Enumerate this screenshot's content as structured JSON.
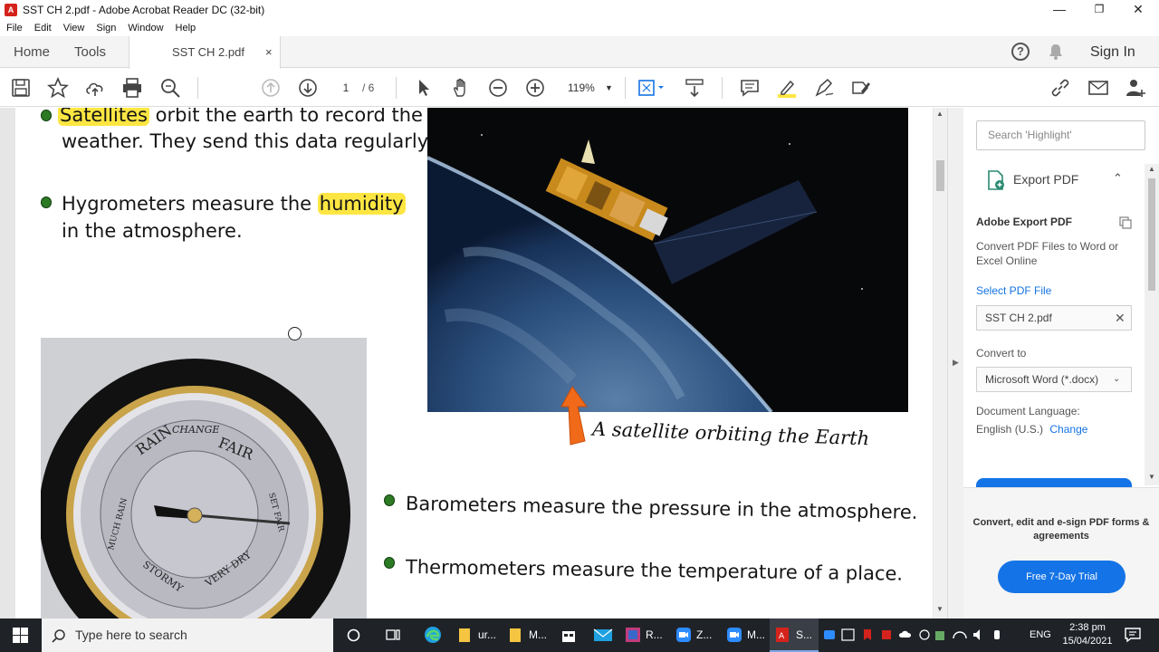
{
  "window": {
    "title": "SST CH 2.pdf - Adobe Acrobat Reader DC (32-bit)",
    "minimize": "—",
    "maximize": "❐",
    "close": "✕"
  },
  "menu": [
    "File",
    "Edit",
    "View",
    "Sign",
    "Window",
    "Help"
  ],
  "tabs": {
    "home": "Home",
    "tools": "Tools",
    "document": "SST CH 2.pdf",
    "close": "×",
    "help": "?",
    "signin": "Sign In"
  },
  "toolbar": {
    "current_page": "1",
    "total_pages": "/ 6",
    "zoom": "119%",
    "zoom_caret": "▼"
  },
  "page": {
    "bullet1_highlight": "Satellites",
    "bullet1_line1_rest": " orbit the earth to record the",
    "bullet1_line2": "weather. They send this data regularly.",
    "bullet2_line1": "Hygrometers measure the ",
    "bullet2_highlight": "humidity",
    "bullet2_line2": "in the atmosphere.",
    "caption": "A satellite orbiting the Earth",
    "bullet3": "Barometers measure the pressure in the atmosphere.",
    "bullet4": "Thermometers measure the temperature of a place.",
    "barometer_labels": [
      "RAIN",
      "FAIR",
      "CHANGE",
      "STORMY",
      "VERY DRY",
      "MUCH RAIN",
      "SET FAIR"
    ]
  },
  "right_panel": {
    "search_placeholder": "Search 'Highlight'",
    "export_label": "Export PDF",
    "export_caret": "⌃",
    "aep_title": "Adobe Export PDF",
    "aep_desc": "Convert PDF Files to Word or Excel Online",
    "select_link": "Select PDF File",
    "file_name": "SST CH 2.pdf",
    "file_clear": "✕",
    "convert_to_label": "Convert to",
    "convert_to_value": "Microsoft Word (*.docx)",
    "convert_caret": "⌄",
    "doc_lang_label": "Document Language:",
    "doc_lang_value": "English (U.S.)",
    "doc_lang_change": "Change",
    "promo": "Convert, edit and e-sign PDF forms & agreements",
    "trial_button": "Free 7-Day Trial"
  },
  "taskbar": {
    "search_placeholder": "Type here to search",
    "items": [
      "ur...",
      "M...",
      "R...",
      "Z...",
      "M...",
      "S..."
    ],
    "lang": "ENG",
    "time": "2:38 pm",
    "date": "15/04/2021"
  },
  "colors": {
    "highlight": "#fde642",
    "acrobat_red": "#d4231c",
    "link_blue": "#1473e6",
    "bullet_green": "#2d7a24",
    "taskbar": "#1f2328"
  }
}
